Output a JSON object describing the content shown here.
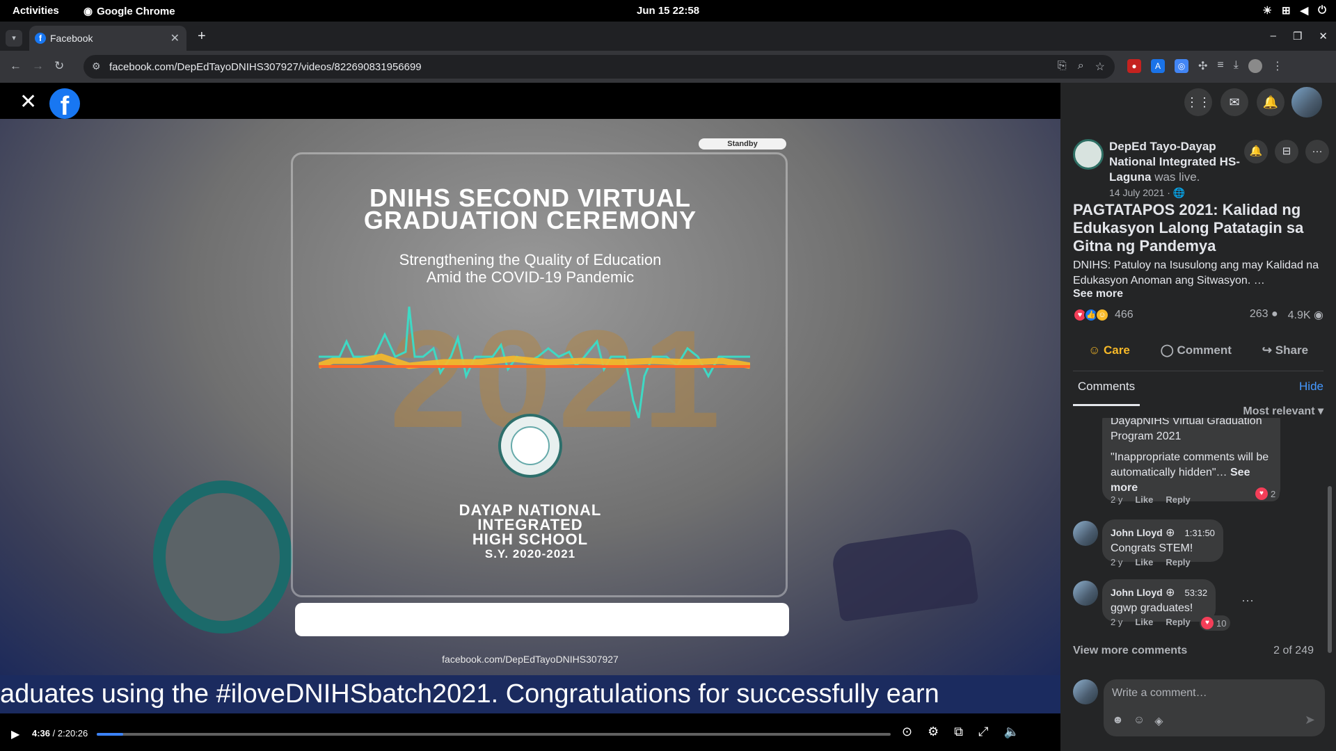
{
  "os": {
    "activities": "Activities",
    "app_name": "Google Chrome",
    "clock": "Jun 15  22:58"
  },
  "browser": {
    "tab_title": "Facebook",
    "url": "facebook.com/DepEdTayoDNIHS307927/videos/822690831956699"
  },
  "video": {
    "standby_label": "Standby",
    "title_line1": "DNIHS SECOND VIRTUAL",
    "title_line2": "GRADUATION CEREMONY",
    "subtitle_line1": "Strengthening the Quality of Education",
    "subtitle_line2": "Amid the COVID-19 Pandemic",
    "school_line1": "DAYAP NATIONAL",
    "school_line2": "INTEGRATED",
    "school_line3": "HIGH SCHOOL",
    "school_year": "S.Y. 2020-2021",
    "page_url": "facebook.com/DepEdTayoDNIHS307927",
    "ticker": "aduates using the #iloveDNIHSbatch2021. Congratulations for successfully earn",
    "current_time": "4:36",
    "duration": "/ 2:20:26",
    "progress_fraction": 0.033
  },
  "post": {
    "page_name": "DepEd Tayo-Dayap National Integrated HS-Laguna",
    "was_live": "was live.",
    "date": "14 July 2021 · ",
    "title": "PAGTATAPOS 2021: Kalidad ng Edukasyon Lalong Patatagin sa Gitna ng Pandemya",
    "description": "DNIHS: Patuloy na Isusulong ang may Kalidad na Edukasyon Anoman ang Sitwasyon. …",
    "see_more": "See more",
    "reaction_count": "466",
    "comment_count": "263",
    "view_count": "4.9K",
    "action_care": "Care",
    "action_comment": "Comment",
    "action_share": "Share"
  },
  "comments_panel": {
    "tab_label": "Comments",
    "hide_label": "Hide",
    "sort_label": "Most relevant",
    "comments": [
      {
        "text_line1": "DayapNIHS Virtual Graduation",
        "text_line2": "Program 2021",
        "text_line3": "\"Inappropriate comments will be automatically hidden\"…",
        "see_more": "See more",
        "age": "2 y",
        "like": "Like",
        "reply": "Reply",
        "reactions": "2"
      },
      {
        "author": "John Lloyd",
        "timestamp": "1:31:50",
        "text": "Congrats STEM!",
        "age": "2 y",
        "like": "Like",
        "reply": "Reply"
      },
      {
        "author": "John Lloyd",
        "timestamp": "53:32",
        "text": "ggwp graduates!",
        "age": "2 y",
        "like": "Like",
        "reply": "Reply",
        "reactions": "10"
      }
    ],
    "view_more": "View more comments",
    "pager": "2 of 249",
    "composer_placeholder": "Write a comment…"
  }
}
